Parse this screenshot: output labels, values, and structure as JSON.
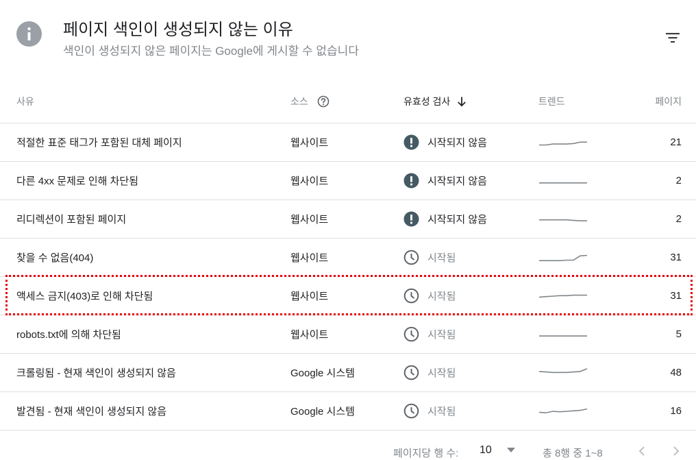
{
  "header": {
    "title": "페이지 색인이 생성되지 않는 이유",
    "subtitle": "색인이 생성되지 않은 페이지는 Google에 게시할 수 없습니다",
    "icon": "info-icon",
    "filter_icon": "filter-icon"
  },
  "columns": {
    "reason": "사유",
    "source": "소스",
    "validation": "유효성 검사",
    "trend": "트렌드",
    "pages": "페이지"
  },
  "rows": [
    {
      "reason": "적절한 표준 태그가 포함된 대체 페이지",
      "source": "웹사이트",
      "validation": "시작되지 않음",
      "status": "not-started",
      "pages": "21",
      "trend": [
        0.25,
        0.25,
        0.35,
        0.35,
        0.35,
        0.4,
        0.55,
        0.55
      ]
    },
    {
      "reason": "다른 4xx 문제로 인해 차단됨",
      "source": "웹사이트",
      "validation": "시작되지 않음",
      "status": "not-started",
      "pages": "2",
      "trend": [
        0.3,
        0.3,
        0.3,
        0.3,
        0.3,
        0.3,
        0.3,
        0.3
      ]
    },
    {
      "reason": "리디렉션이 포함된 페이지",
      "source": "웹사이트",
      "validation": "시작되지 않음",
      "status": "not-started",
      "pages": "2",
      "trend": [
        0.45,
        0.45,
        0.45,
        0.45,
        0.45,
        0.4,
        0.35,
        0.35
      ]
    },
    {
      "reason": "찾을 수 없음(404)",
      "source": "웹사이트",
      "validation": "시작됨",
      "status": "started",
      "pages": "31",
      "trend": [
        0.2,
        0.2,
        0.2,
        0.2,
        0.25,
        0.25,
        0.7,
        0.75
      ]
    },
    {
      "reason": "액세스 금지(403)로 인해 차단됨",
      "source": "웹사이트",
      "validation": "시작됨",
      "status": "started",
      "pages": "31",
      "trend": [
        0.4,
        0.45,
        0.5,
        0.55,
        0.55,
        0.6,
        0.6,
        0.6
      ]
    },
    {
      "reason": "robots.txt에 의해 차단됨",
      "source": "웹사이트",
      "validation": "시작됨",
      "status": "started",
      "pages": "5",
      "trend": [
        0.35,
        0.35,
        0.35,
        0.35,
        0.35,
        0.35,
        0.35,
        0.35
      ]
    },
    {
      "reason": "크롤링됨 - 현재 색인이 생성되지 않음",
      "source": "Google 시스템",
      "validation": "시작됨",
      "status": "started",
      "pages": "48",
      "trend": [
        0.65,
        0.6,
        0.55,
        0.55,
        0.55,
        0.6,
        0.65,
        0.95
      ]
    },
    {
      "reason": "발견됨 - 현재 색인이 생성되지 않음",
      "source": "Google 시스템",
      "validation": "시작됨",
      "status": "started",
      "pages": "16",
      "trend": [
        0.4,
        0.35,
        0.5,
        0.45,
        0.5,
        0.55,
        0.6,
        0.75
      ]
    }
  ],
  "highlighted_row": 4,
  "footer": {
    "rows_per_page_label": "페이지당 행 수:",
    "rows_per_page_value": "10",
    "range_text": "총 8행 중 1~8"
  },
  "colors": {
    "not_started_icon": "#455a64",
    "started_icon": "#5f6368",
    "sparkline": "#80868b",
    "highlight": "#e8000b"
  }
}
